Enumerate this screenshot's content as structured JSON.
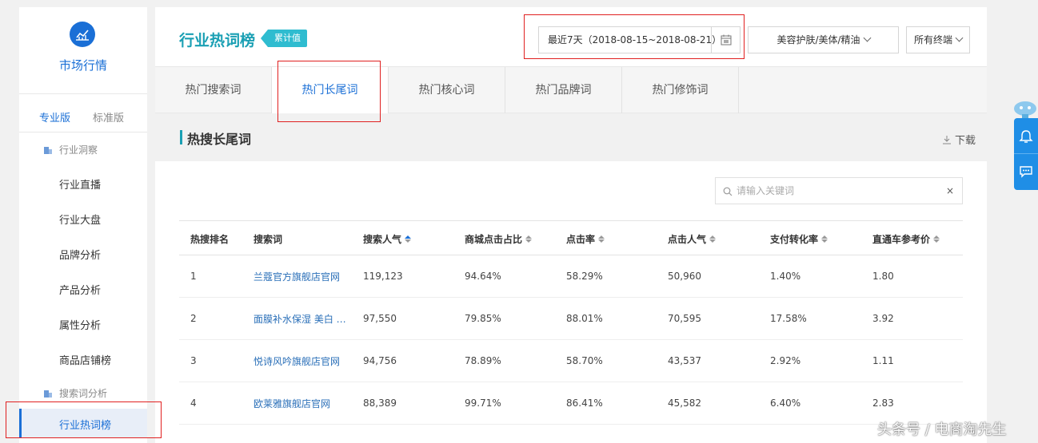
{
  "sidebar": {
    "title": "市场行情",
    "editions": [
      "专业版",
      "标准版"
    ],
    "groups": [
      {
        "label": "行业洞察"
      },
      {
        "label": "搜索词分析"
      }
    ],
    "items": [
      "行业直播",
      "行业大盘",
      "品牌分析",
      "产品分析",
      "属性分析",
      "商品店铺榜"
    ],
    "active_item": "行业热词榜"
  },
  "header": {
    "title": "行业热词榜",
    "badge": "累计值",
    "date_range": "最近7天（2018-08-15~2018-08-21）",
    "category": "美容护肤/美体/精油",
    "terminal": "所有终端"
  },
  "tabs": [
    "热门搜索词",
    "热门长尾词",
    "热门核心词",
    "热门品牌词",
    "热门修饰词"
  ],
  "section": {
    "title": "热搜长尾词",
    "download": "下载",
    "search_placeholder": "请输入关键词",
    "clear": "×"
  },
  "table": {
    "columns": [
      "热搜排名",
      "搜索词",
      "搜索人气",
      "商城点击占比",
      "点击率",
      "点击人气",
      "支付转化率",
      "直通车参考价"
    ],
    "rows": [
      [
        "1",
        "兰蔻官方旗舰店官网",
        "119,123",
        "94.64%",
        "58.29%",
        "50,960",
        "1.40%",
        "1.80"
      ],
      [
        "2",
        "面膜补水保湿 美白 …",
        "97,550",
        "79.85%",
        "88.01%",
        "70,595",
        "17.58%",
        "3.92"
      ],
      [
        "3",
        "悦诗风吟旗舰店官网",
        "94,756",
        "78.89%",
        "58.70%",
        "43,537",
        "2.92%",
        "1.11"
      ],
      [
        "4",
        "欧莱雅旗舰店官网",
        "88,389",
        "99.71%",
        "86.41%",
        "45,582",
        "6.40%",
        "2.83"
      ]
    ]
  },
  "watermark": "头条号 / 电商淘先生",
  "colors": {
    "accent": "#1a6fd6",
    "title": "#1ba0b4",
    "annotation": "#e02020"
  }
}
